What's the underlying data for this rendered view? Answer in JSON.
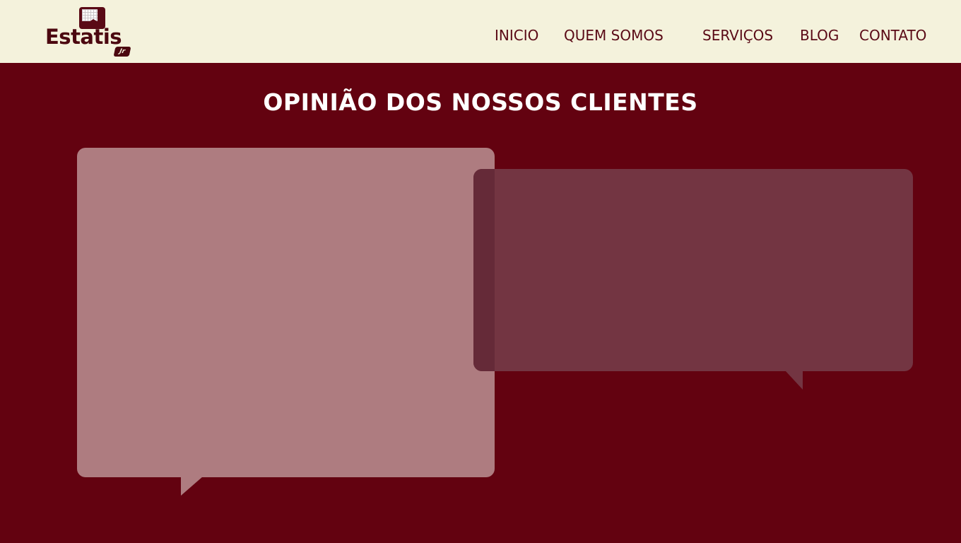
{
  "header": {
    "logo": {
      "name": "Estatis",
      "suffix": "Jr"
    },
    "nav": [
      {
        "label": "INICIO"
      },
      {
        "label": "QUEM SOMOS"
      },
      {
        "label": "SERVIÇOS"
      },
      {
        "label": "BLOG"
      },
      {
        "label": "CONTATO"
      }
    ]
  },
  "testimonials": {
    "title": "OPINIÃO DOS NOSSOS CLIENTES"
  },
  "colors": {
    "header_bg": "#f4f2dc",
    "page_bg": "#630210",
    "brand": "#5a0a16",
    "bubble_light": "#ae7c80",
    "bubble_dark": "#733542"
  }
}
